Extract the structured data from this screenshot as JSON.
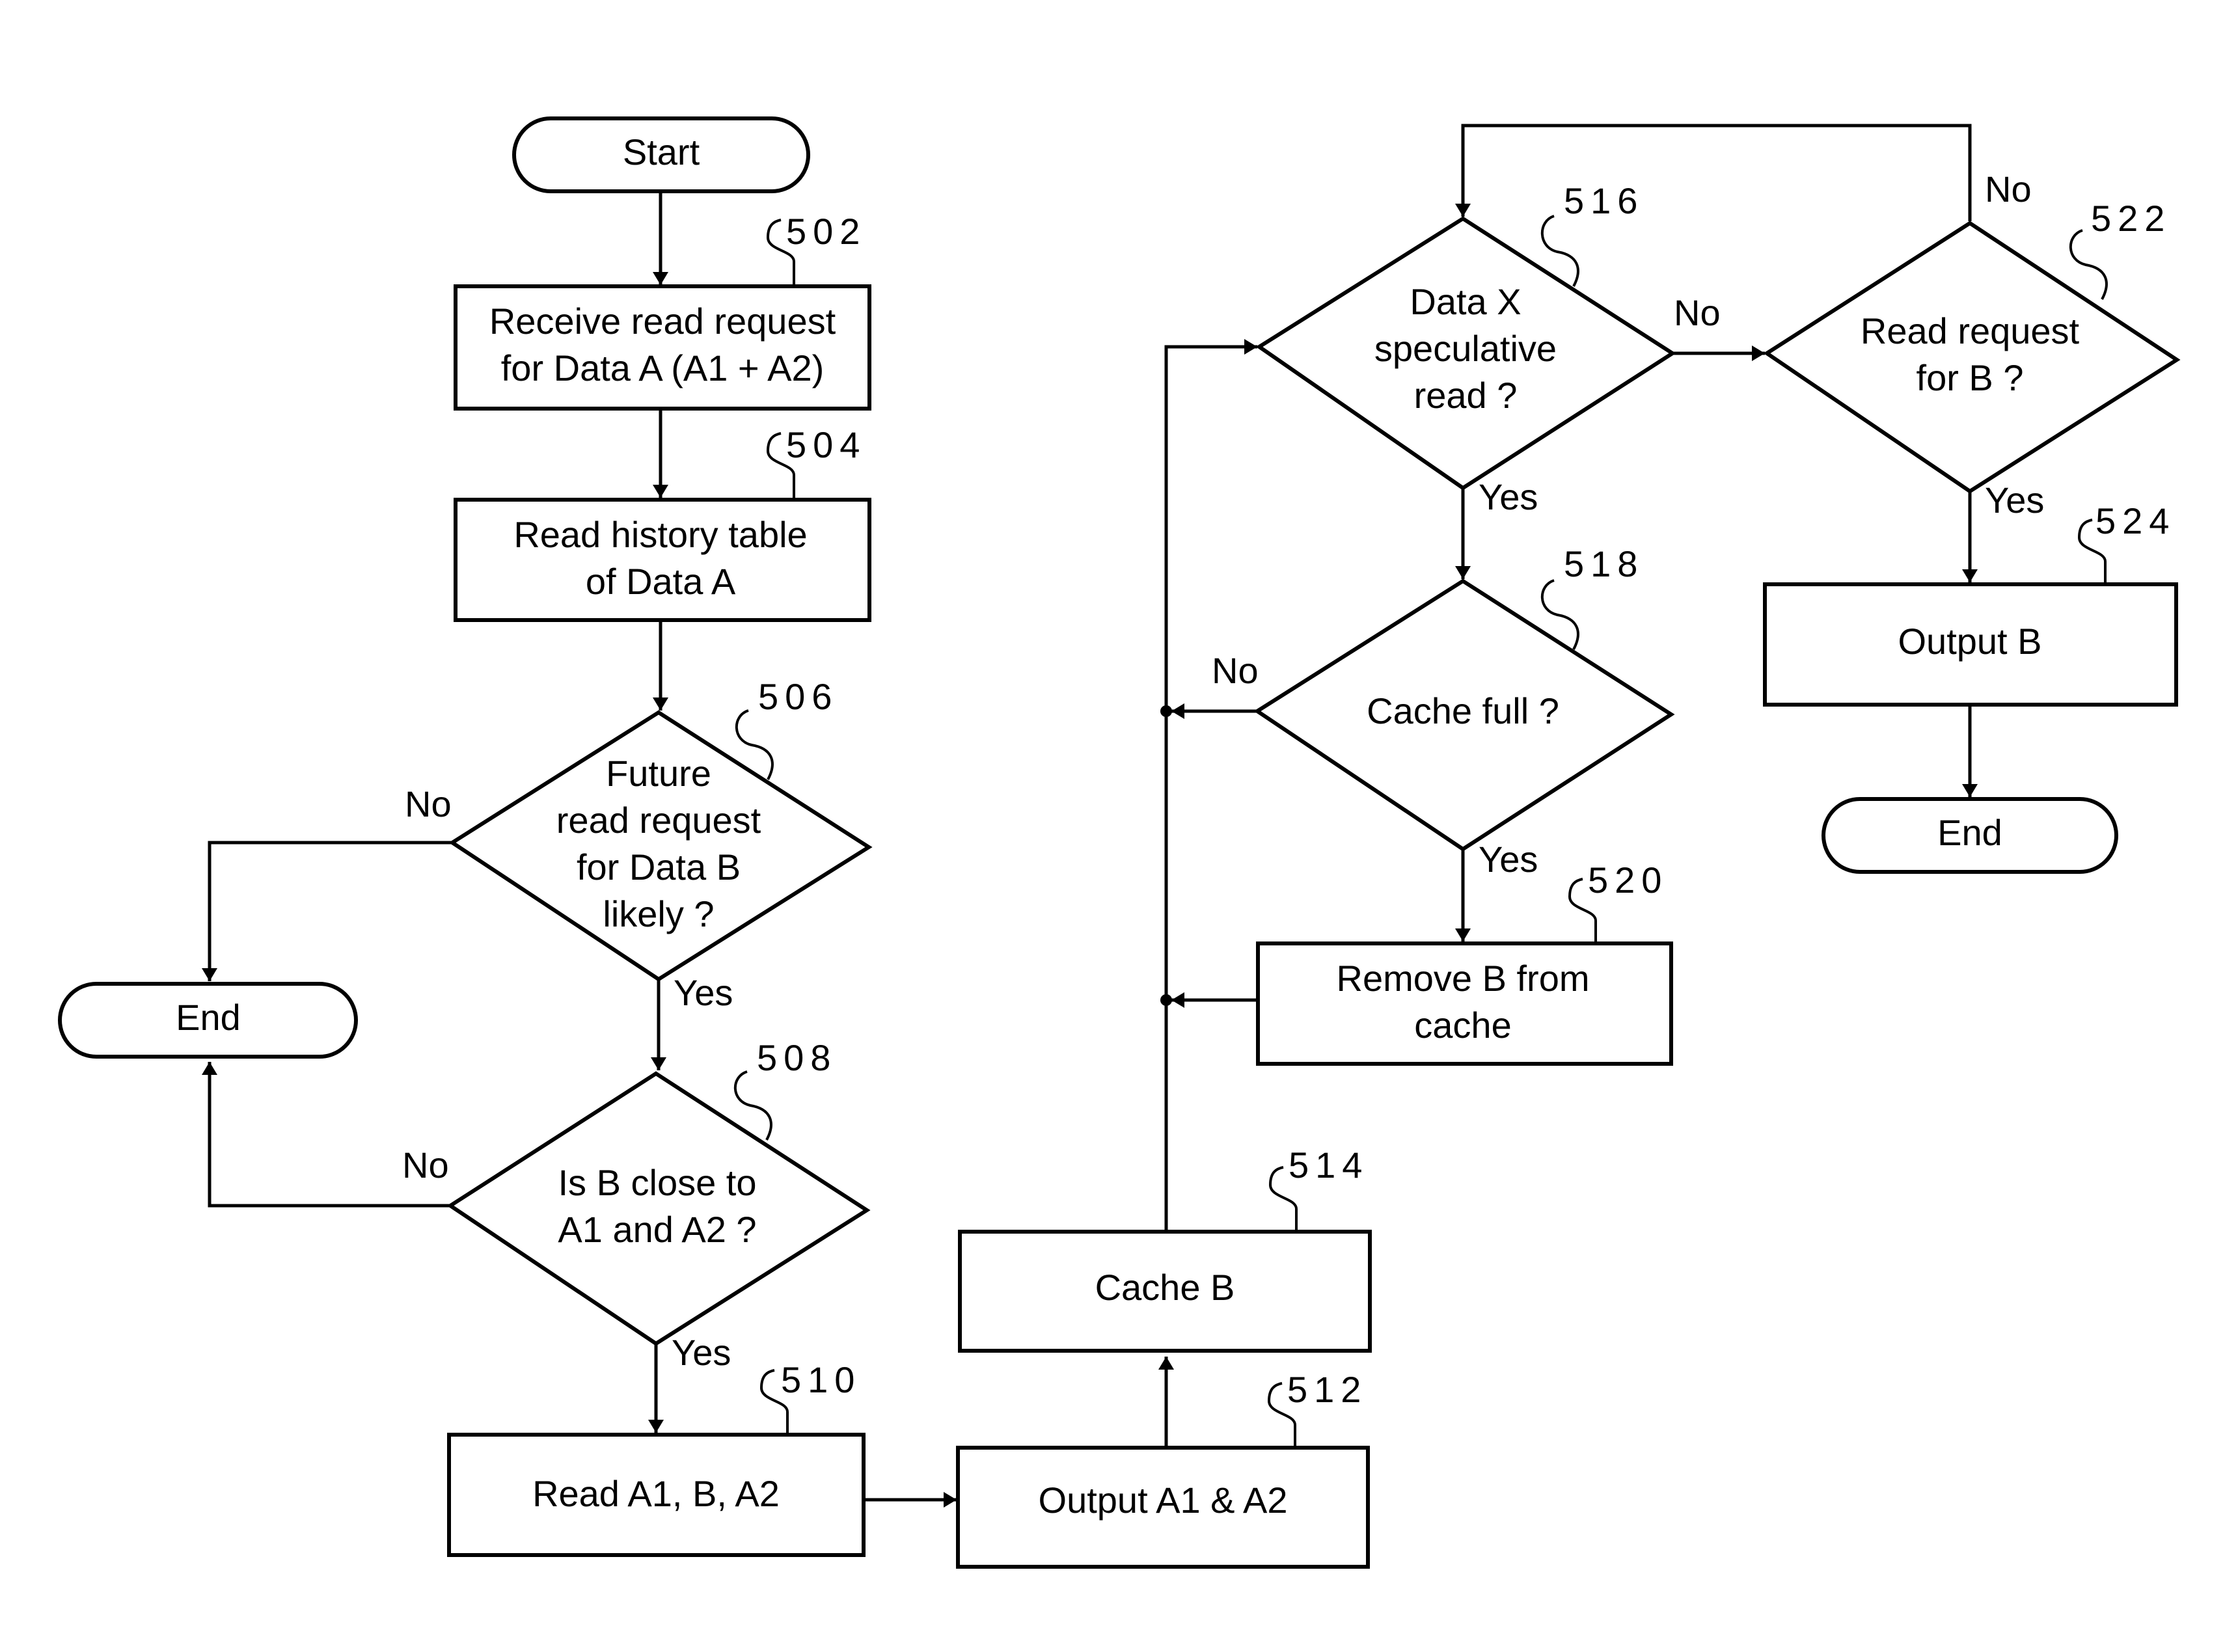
{
  "nodes": {
    "start": {
      "text": [
        "Start"
      ]
    },
    "n502": {
      "ref": "502",
      "text": [
        "Receive read request",
        "for Data A (A1 + A2)"
      ]
    },
    "n504": {
      "ref": "504",
      "text": [
        "Read history table",
        "of Data A"
      ]
    },
    "n506": {
      "ref": "506",
      "text": [
        "Future",
        "read request",
        "for Data B",
        "likely ?"
      ]
    },
    "end_left": {
      "text": [
        "End"
      ]
    },
    "n508": {
      "ref": "508",
      "text": [
        "Is B close to",
        "A1 and A2 ?"
      ]
    },
    "n510": {
      "ref": "510",
      "text": [
        "Read A1, B, A2"
      ]
    },
    "n512": {
      "ref": "512",
      "text": [
        "Output A1 & A2"
      ]
    },
    "n514": {
      "ref": "514",
      "text": [
        "Cache B"
      ]
    },
    "n516": {
      "ref": "516",
      "text": [
        "Data X",
        "speculative",
        "read ?"
      ]
    },
    "n518": {
      "ref": "518",
      "text": [
        "Cache full ?"
      ]
    },
    "n520": {
      "ref": "520",
      "text": [
        "Remove B from",
        "cache"
      ]
    },
    "n522": {
      "ref": "522",
      "text": [
        "Read request",
        "for B ?"
      ]
    },
    "n524": {
      "ref": "524",
      "text": [
        "Output B"
      ]
    },
    "end_right": {
      "text": [
        "End"
      ]
    }
  },
  "edge_labels": {
    "n506_no": "No",
    "n506_yes": "Yes",
    "n508_no": "No",
    "n508_yes": "Yes",
    "n516_no": "No",
    "n516_yes": "Yes",
    "n518_no": "No",
    "n518_yes": "Yes",
    "n522_no": "No",
    "n522_yes": "Yes"
  }
}
